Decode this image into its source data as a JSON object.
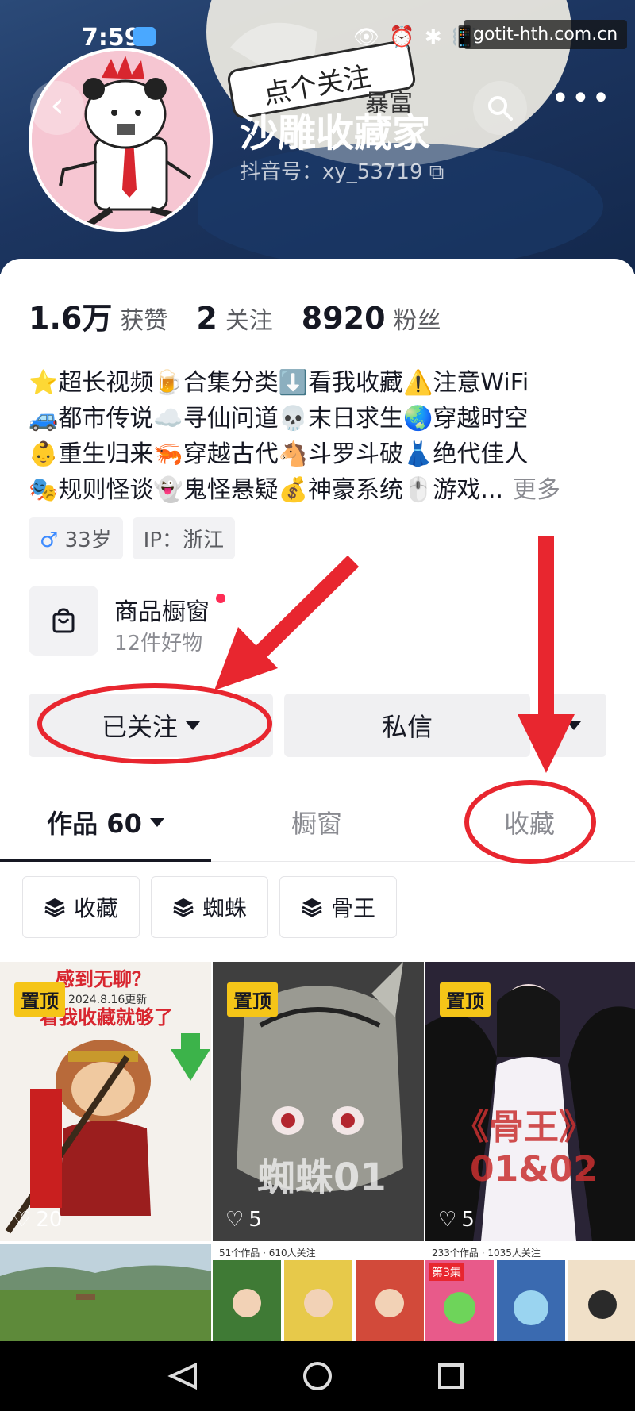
{
  "status_bar": {
    "time": "7:59",
    "watermark": "gotit-hth.com.cn"
  },
  "profile": {
    "name": "沙雕收藏家",
    "douyin_id": "抖音号：xy_53719"
  },
  "stats": [
    {
      "value": "1.6万",
      "label": "获赞"
    },
    {
      "value": "2",
      "label": "关注"
    },
    {
      "value": "8920",
      "label": "粉丝"
    }
  ],
  "bio": {
    "lines": [
      "⭐超长视频🍺合集分类⬇️看我收藏⚠️注意WiFi",
      "🚙都市传说☁️寻仙问道💀末日求生🌏穿越时空",
      "👶重生归来🦐穿越古代🐴斗罗斗破👗绝代佳人",
      "🎭规则怪谈👻鬼怪悬疑💰神豪系统🖱️游戏..."
    ],
    "more": "更多"
  },
  "tags": {
    "age": "33岁",
    "ip": "IP：浙江",
    "male_symbol": "♂"
  },
  "shop": {
    "title": "商品橱窗",
    "subtitle": "12件好物"
  },
  "buttons": {
    "follow": "已关注",
    "message": "私信"
  },
  "tabs": {
    "works": "作品 60",
    "window": "橱窗",
    "favorites": "收藏"
  },
  "collections": [
    "收藏",
    "蜘蛛",
    "骨王"
  ],
  "videos": [
    {
      "pinned": "置顶",
      "likes": "20",
      "caption_top": "感到无聊？",
      "caption_date": "2024.8.16更新",
      "caption_mid": "看我收藏就够了"
    },
    {
      "pinned": "置顶",
      "likes": "5",
      "caption": "蜘蛛01"
    },
    {
      "pinned": "置顶",
      "likes": "5",
      "caption": "《骨王》",
      "caption2": "01&02"
    }
  ],
  "thumbs_row2": [
    {
      "caption": ""
    },
    {
      "caption": "51个作品 · 610人关注"
    },
    {
      "caption": "233个作品 · 1035人关注",
      "badge": "第3集"
    }
  ],
  "colors": {
    "accent_red": "#e8262f",
    "pin_yellow": "#f5c518",
    "header_blue": "#1c3560"
  }
}
